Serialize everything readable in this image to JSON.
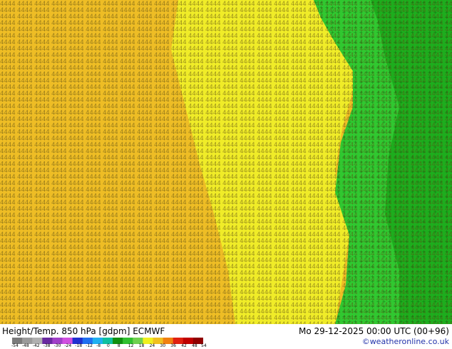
{
  "map": {
    "variable": "Height/Temp. 850 hPa [gdpm] ECMWF",
    "valid_time": "Mo 29-12-2025 00:00 UTC (00+96)",
    "credit": "©weatheronline.co.uk",
    "colors": {
      "dark_green": "#19a619",
      "green": "#30c830",
      "yellow": "#f0ec28",
      "gold": "#f0c828",
      "orange": "#eaa620"
    },
    "colorbar": {
      "tick_labels": [
        "-54",
        "-48",
        "-42",
        "-38",
        "-30",
        "-24",
        "-18",
        "-12",
        "-8",
        "0",
        "8",
        "12",
        "18",
        "24",
        "30",
        "36",
        "42",
        "48",
        "54"
      ],
      "colors": [
        "#7a7a7a",
        "#9a9a9a",
        "#b0b0b0",
        "#6a2aa0",
        "#a040c8",
        "#d050e0",
        "#2030d0",
        "#2070f0",
        "#20b0f0",
        "#10c0a0",
        "#109010",
        "#30c030",
        "#70d050",
        "#f0f020",
        "#f0c020",
        "#f08010",
        "#e02010",
        "#c00000",
        "#900000"
      ]
    }
  }
}
